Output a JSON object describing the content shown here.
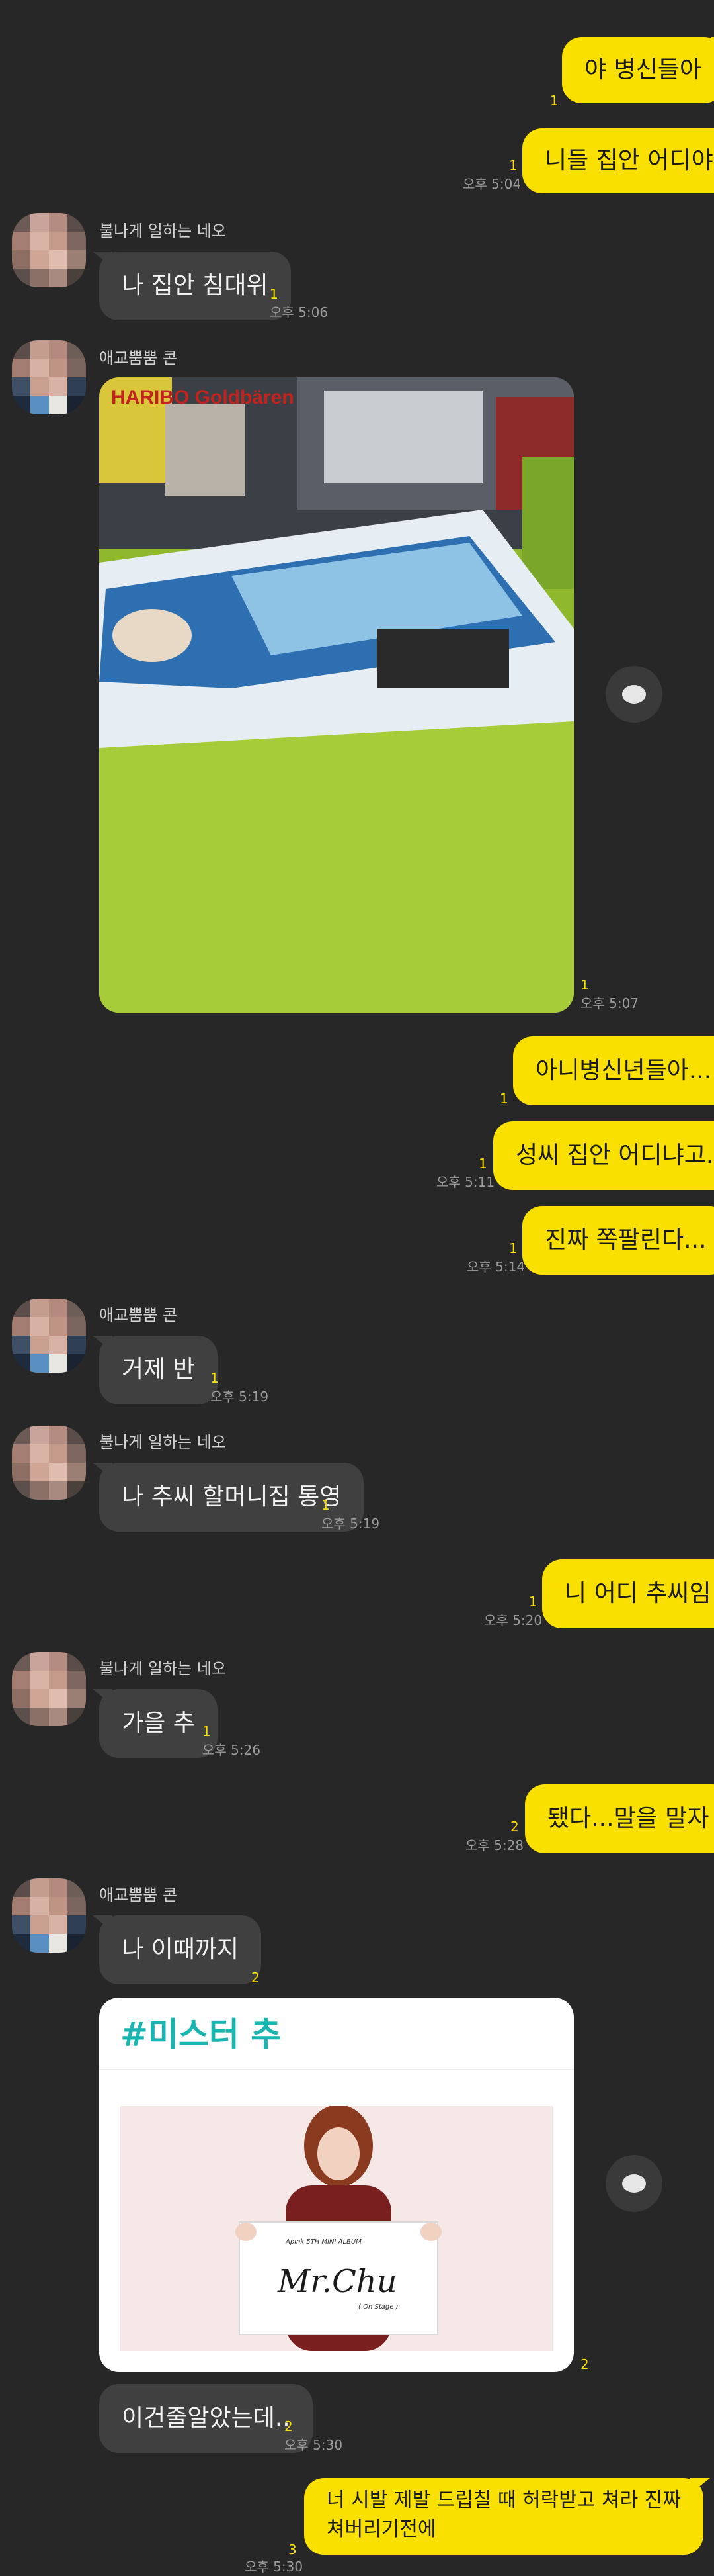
{
  "colors": {
    "background": "#272727",
    "my_bubble": "#f9e000",
    "their_bubble": "#404040",
    "card_title": "#19b5b0"
  },
  "messages": {
    "m1": {
      "text": "야 병신들아",
      "unread": "1"
    },
    "m2": {
      "text": "니들 집안 어디야",
      "unread": "1",
      "time": "오후 5:04"
    },
    "m3": {
      "sender": "불나게 일하는 네오",
      "text": "나 집안 침대위",
      "unread": "1",
      "time": "오후 5:06"
    },
    "m4": {
      "sender": "애교뿜뿜 콘",
      "photo_text": "HARIBO Goldbären",
      "unread": "1",
      "time": "오후 5:07"
    },
    "m5": {
      "text": "아니병신년들아...",
      "unread": "1"
    },
    "m6": {
      "text": "성씨 집안 어디냐고..",
      "unread": "1",
      "time": "오후 5:11"
    },
    "m7": {
      "text": "진짜 쪽팔린다...",
      "unread": "1",
      "time": "오후 5:14"
    },
    "m8": {
      "sender": "애교뿜뿜 콘",
      "text": "거제 반",
      "unread": "1",
      "time": "오후 5:19"
    },
    "m9": {
      "sender": "불나게 일하는 네오",
      "text": "나 추씨 할머니집 통영",
      "unread": "1",
      "time": "오후 5:19"
    },
    "m10": {
      "text": "니 어디 추씨임",
      "unread": "1",
      "time": "오후 5:20"
    },
    "m11": {
      "sender": "불나게 일하는 네오",
      "text": "가을 추",
      "unread": "1",
      "time": "오후 5:26"
    },
    "m12": {
      "text": "됐다...말을 말자",
      "unread": "2",
      "time": "오후 5:28"
    },
    "m13": {
      "sender": "애교뿜뿜 콘",
      "text": "나 이때까지",
      "unread": "2"
    },
    "m14": {
      "card_title": "#미스터 추",
      "album_small": "Apink 5TH MINI ALBUM",
      "album_title": "Mr.Chu",
      "album_sub": "( On Stage )",
      "unread": "2"
    },
    "m15": {
      "text": "이건줄알았는데..",
      "unread": "2",
      "time": "오후 5:30"
    },
    "m16": {
      "line1": "너 시발 제발 드립칠 때 허락받고 쳐라 진짜",
      "line2": "쳐버리기전에",
      "unread": "3",
      "time": "오후 5:30"
    }
  }
}
